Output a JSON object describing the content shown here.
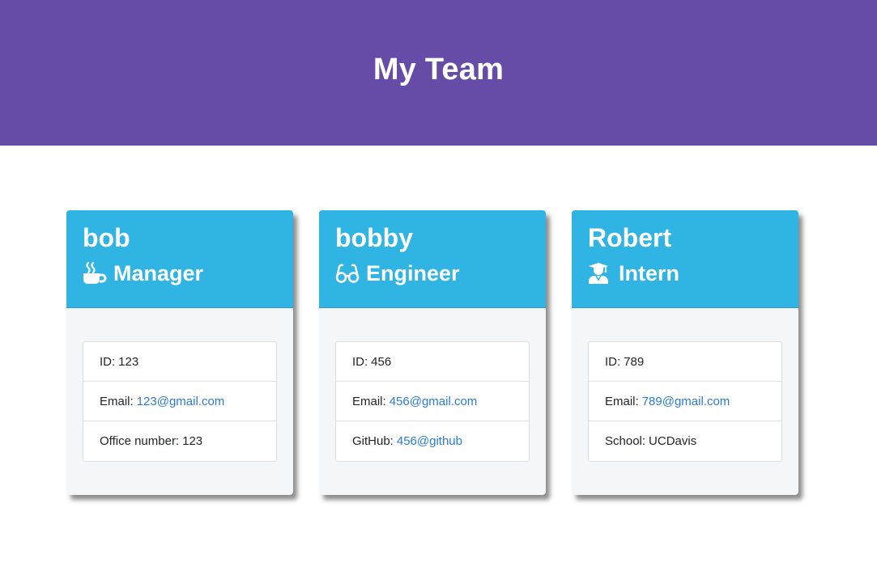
{
  "header": {
    "title": "My Team"
  },
  "colors": {
    "header_bg": "#644ca7",
    "card_header_bg": "#30b4e4",
    "link": "#2a7bd6"
  },
  "employees": [
    {
      "name": "bob",
      "role": "Manager",
      "icon": "coffee-icon",
      "id_label": "ID:",
      "id": "123",
      "email_label": "Email:",
      "email": "123@gmail.com",
      "extra_label": "Office number:",
      "extra_value": "123"
    },
    {
      "name": "bobby",
      "role": "Engineer",
      "icon": "glasses-icon",
      "id_label": "ID:",
      "id": "456",
      "email_label": "Email:",
      "email": "456@gmail.com",
      "extra_label": "GitHub:",
      "extra_value": "456@github"
    },
    {
      "name": "Robert",
      "role": "Intern",
      "icon": "graduate-icon",
      "id_label": "ID:",
      "id": "789",
      "email_label": "Email:",
      "email": "789@gmail.com",
      "extra_label": "School:",
      "extra_value": "UCDavis"
    }
  ]
}
